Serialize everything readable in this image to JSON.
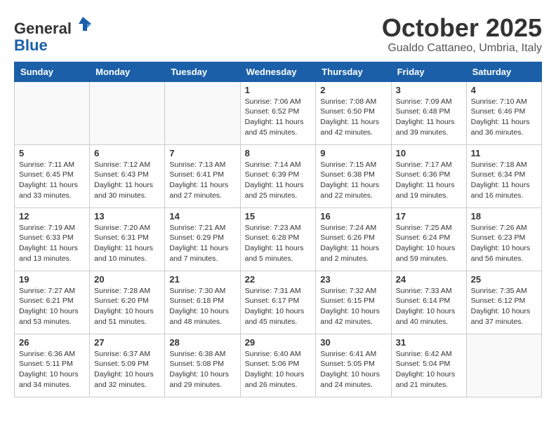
{
  "header": {
    "logo_line1": "General",
    "logo_line2": "Blue",
    "month_title": "October 2025",
    "subtitle": "Gualdo Cattaneo, Umbria, Italy"
  },
  "weekdays": [
    "Sunday",
    "Monday",
    "Tuesday",
    "Wednesday",
    "Thursday",
    "Friday",
    "Saturday"
  ],
  "weeks": [
    [
      {
        "day": "",
        "info": ""
      },
      {
        "day": "",
        "info": ""
      },
      {
        "day": "",
        "info": ""
      },
      {
        "day": "1",
        "info": "Sunrise: 7:06 AM\nSunset: 6:52 PM\nDaylight: 11 hours and 45 minutes."
      },
      {
        "day": "2",
        "info": "Sunrise: 7:08 AM\nSunset: 6:50 PM\nDaylight: 11 hours and 42 minutes."
      },
      {
        "day": "3",
        "info": "Sunrise: 7:09 AM\nSunset: 6:48 PM\nDaylight: 11 hours and 39 minutes."
      },
      {
        "day": "4",
        "info": "Sunrise: 7:10 AM\nSunset: 6:46 PM\nDaylight: 11 hours and 36 minutes."
      }
    ],
    [
      {
        "day": "5",
        "info": "Sunrise: 7:11 AM\nSunset: 6:45 PM\nDaylight: 11 hours and 33 minutes."
      },
      {
        "day": "6",
        "info": "Sunrise: 7:12 AM\nSunset: 6:43 PM\nDaylight: 11 hours and 30 minutes."
      },
      {
        "day": "7",
        "info": "Sunrise: 7:13 AM\nSunset: 6:41 PM\nDaylight: 11 hours and 27 minutes."
      },
      {
        "day": "8",
        "info": "Sunrise: 7:14 AM\nSunset: 6:39 PM\nDaylight: 11 hours and 25 minutes."
      },
      {
        "day": "9",
        "info": "Sunrise: 7:15 AM\nSunset: 6:38 PM\nDaylight: 11 hours and 22 minutes."
      },
      {
        "day": "10",
        "info": "Sunrise: 7:17 AM\nSunset: 6:36 PM\nDaylight: 11 hours and 19 minutes."
      },
      {
        "day": "11",
        "info": "Sunrise: 7:18 AM\nSunset: 6:34 PM\nDaylight: 11 hours and 16 minutes."
      }
    ],
    [
      {
        "day": "12",
        "info": "Sunrise: 7:19 AM\nSunset: 6:33 PM\nDaylight: 11 hours and 13 minutes."
      },
      {
        "day": "13",
        "info": "Sunrise: 7:20 AM\nSunset: 6:31 PM\nDaylight: 11 hours and 10 minutes."
      },
      {
        "day": "14",
        "info": "Sunrise: 7:21 AM\nSunset: 6:29 PM\nDaylight: 11 hours and 7 minutes."
      },
      {
        "day": "15",
        "info": "Sunrise: 7:23 AM\nSunset: 6:28 PM\nDaylight: 11 hours and 5 minutes."
      },
      {
        "day": "16",
        "info": "Sunrise: 7:24 AM\nSunset: 6:26 PM\nDaylight: 11 hours and 2 minutes."
      },
      {
        "day": "17",
        "info": "Sunrise: 7:25 AM\nSunset: 6:24 PM\nDaylight: 10 hours and 59 minutes."
      },
      {
        "day": "18",
        "info": "Sunrise: 7:26 AM\nSunset: 6:23 PM\nDaylight: 10 hours and 56 minutes."
      }
    ],
    [
      {
        "day": "19",
        "info": "Sunrise: 7:27 AM\nSunset: 6:21 PM\nDaylight: 10 hours and 53 minutes."
      },
      {
        "day": "20",
        "info": "Sunrise: 7:28 AM\nSunset: 6:20 PM\nDaylight: 10 hours and 51 minutes."
      },
      {
        "day": "21",
        "info": "Sunrise: 7:30 AM\nSunset: 6:18 PM\nDaylight: 10 hours and 48 minutes."
      },
      {
        "day": "22",
        "info": "Sunrise: 7:31 AM\nSunset: 6:17 PM\nDaylight: 10 hours and 45 minutes."
      },
      {
        "day": "23",
        "info": "Sunrise: 7:32 AM\nSunset: 6:15 PM\nDaylight: 10 hours and 42 minutes."
      },
      {
        "day": "24",
        "info": "Sunrise: 7:33 AM\nSunset: 6:14 PM\nDaylight: 10 hours and 40 minutes."
      },
      {
        "day": "25",
        "info": "Sunrise: 7:35 AM\nSunset: 6:12 PM\nDaylight: 10 hours and 37 minutes."
      }
    ],
    [
      {
        "day": "26",
        "info": "Sunrise: 6:36 AM\nSunset: 5:11 PM\nDaylight: 10 hours and 34 minutes."
      },
      {
        "day": "27",
        "info": "Sunrise: 6:37 AM\nSunset: 5:09 PM\nDaylight: 10 hours and 32 minutes."
      },
      {
        "day": "28",
        "info": "Sunrise: 6:38 AM\nSunset: 5:08 PM\nDaylight: 10 hours and 29 minutes."
      },
      {
        "day": "29",
        "info": "Sunrise: 6:40 AM\nSunset: 5:06 PM\nDaylight: 10 hours and 26 minutes."
      },
      {
        "day": "30",
        "info": "Sunrise: 6:41 AM\nSunset: 5:05 PM\nDaylight: 10 hours and 24 minutes."
      },
      {
        "day": "31",
        "info": "Sunrise: 6:42 AM\nSunset: 5:04 PM\nDaylight: 10 hours and 21 minutes."
      },
      {
        "day": "",
        "info": ""
      }
    ]
  ]
}
